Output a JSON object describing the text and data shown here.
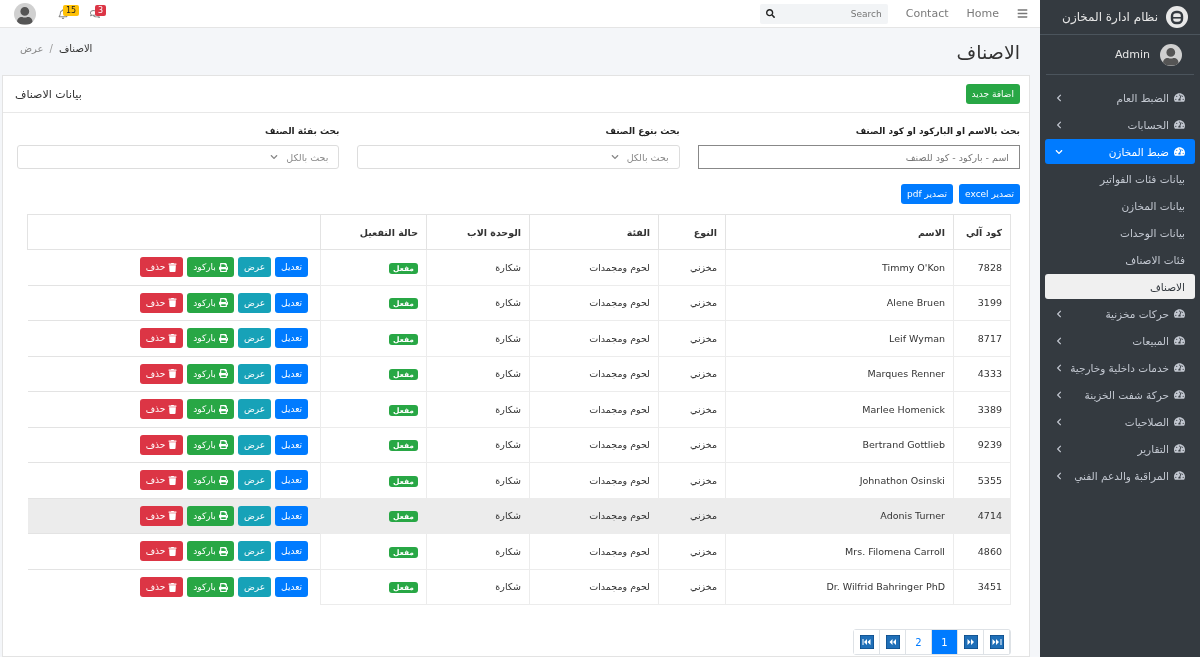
{
  "navbar": {
    "links": [
      "Home",
      "Contact"
    ],
    "search": {
      "placeholder": "Search"
    },
    "badges": [
      {
        "kind": "chat",
        "count": "3",
        "color": "#dc3545"
      },
      {
        "kind": "bell",
        "count": "15",
        "color": "#ffc107"
      }
    ]
  },
  "sidebar": {
    "brand": "نظام ادارة المخازن",
    "user": "Admin",
    "items": [
      {
        "label": "الضبط العام",
        "expanded": false
      },
      {
        "label": "الحسابات",
        "expanded": false
      },
      {
        "label": "ضبط المخازن",
        "expanded": true,
        "children": [
          {
            "label": "بيانات فئات الفواتير",
            "selected": false
          },
          {
            "label": "بيانات المخازن",
            "selected": false
          },
          {
            "label": "بيانات الوحدات",
            "selected": false
          },
          {
            "label": "فئات الاصناف",
            "selected": false
          },
          {
            "label": "الاصناف",
            "selected": true
          }
        ]
      },
      {
        "label": "حركات مخزنية",
        "expanded": false
      },
      {
        "label": "المبيعات",
        "expanded": false
      },
      {
        "label": "خدمات داخلية وخارجية",
        "expanded": false
      },
      {
        "label": "حركة شفت الخزينة",
        "expanded": false
      },
      {
        "label": "الصلاحيات",
        "expanded": false
      },
      {
        "label": "التقارير",
        "expanded": false
      },
      {
        "label": "المراقبة والدعم الفني",
        "expanded": false
      }
    ]
  },
  "page": {
    "title": "الاصناف",
    "breadcrumb": [
      "الاصناف",
      "عرض"
    ],
    "breadcrumb_separator": "/"
  },
  "card": {
    "title": "بيانات الاصناف",
    "add_button": "اضافة جديد",
    "filters": [
      {
        "kind": "text",
        "label": "بحث بالاسم او الباركود او كود الصنف",
        "placeholder": "اسم - باركود - كود للصنف"
      },
      {
        "kind": "select",
        "label": "بحث بنوع الصنف",
        "value": "بحث بالكل"
      },
      {
        "kind": "select",
        "label": "بحث بفئة الصنف",
        "value": "بحث بالكل"
      }
    ],
    "export_buttons": [
      "تصدير excel",
      "تصدير pdf"
    ],
    "table": {
      "columns": [
        "كود آلي",
        "الاسم",
        "النوع",
        "الفئة",
        "الوحدة الاب",
        "حالة التفعيل"
      ],
      "rows": [
        {
          "code": "7828",
          "name": "Timmy O'Kon",
          "type": "مخزني",
          "category": "لحوم ومجمدات",
          "unit": "شكارة",
          "status": "مفعل",
          "highlighted": false,
          "actions": [
            "تعديل",
            "عرض",
            "باركود",
            "حذف"
          ]
        },
        {
          "code": "3199",
          "name": "Alene Bruen",
          "type": "مخزني",
          "category": "لحوم ومجمدات",
          "unit": "شكارة",
          "status": "مفعل",
          "highlighted": false,
          "actions": [
            "تعديل",
            "عرض",
            "باركود",
            "حذف"
          ]
        },
        {
          "code": "8717",
          "name": "Leif Wyman",
          "type": "مخزني",
          "category": "لحوم ومجمدات",
          "unit": "شكارة",
          "status": "مفعل",
          "highlighted": false,
          "actions": [
            "تعديل",
            "عرض",
            "باركود",
            "حذف"
          ]
        },
        {
          "code": "4333",
          "name": "Marques Renner",
          "type": "مخزني",
          "category": "لحوم ومجمدات",
          "unit": "شكارة",
          "status": "مفعل",
          "highlighted": false,
          "actions": [
            "تعديل",
            "عرض",
            "باركود",
            "حذف"
          ]
        },
        {
          "code": "3389",
          "name": "Marlee Homenick",
          "type": "مخزني",
          "category": "لحوم ومجمدات",
          "unit": "شكارة",
          "status": "مفعل",
          "highlighted": false,
          "actions": [
            "تعديل",
            "عرض",
            "باركود",
            "حذف"
          ]
        },
        {
          "code": "9239",
          "name": "Bertrand Gottlieb",
          "type": "مخزني",
          "category": "لحوم ومجمدات",
          "unit": "شكارة",
          "status": "مفعل",
          "highlighted": false,
          "actions": [
            "تعديل",
            "عرض",
            "باركود",
            "حذف"
          ]
        },
        {
          "code": "5355",
          "name": "Johnathon Osinski",
          "type": "مخزني",
          "category": "لحوم ومجمدات",
          "unit": "شكارة",
          "status": "مفعل",
          "highlighted": false,
          "actions": [
            "تعديل",
            "عرض",
            "باركود",
            "حذف"
          ]
        },
        {
          "code": "4714",
          "name": "Adonis Turner",
          "type": "مخزني",
          "category": "لحوم ومجمدات",
          "unit": "شكارة",
          "status": "مفعل",
          "highlighted": true,
          "actions": [
            "تعديل",
            "عرض",
            "باركود",
            "حذف"
          ]
        },
        {
          "code": "4860",
          "name": "Mrs. Filomena Carroll",
          "type": "مخزني",
          "category": "لحوم ومجمدات",
          "unit": "شكارة",
          "status": "مفعل",
          "highlighted": false,
          "actions": [
            "تعديل",
            "عرض",
            "باركود",
            "حذف"
          ]
        },
        {
          "code": "3451",
          "name": "Dr. Wilfrid Bahringer PhD",
          "type": "مخزني",
          "category": "لحوم ومجمدات",
          "unit": "شكارة",
          "status": "مفعل",
          "highlighted": false,
          "actions": [
            "تعديل",
            "عرض",
            "باركود",
            "حذف"
          ]
        }
      ]
    },
    "pagination": {
      "pages": [
        {
          "label": "1",
          "selected": true
        },
        {
          "label": "2",
          "selected": false
        }
      ]
    }
  }
}
